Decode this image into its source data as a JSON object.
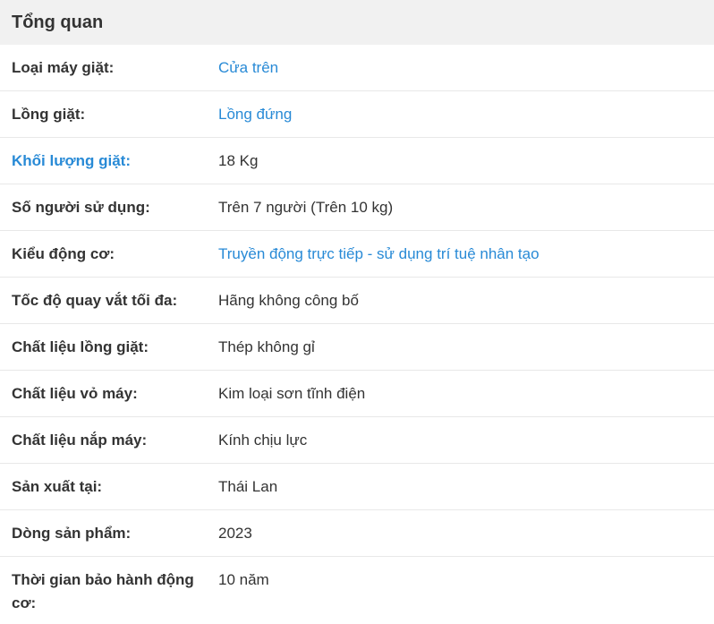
{
  "section": {
    "title": "Tổng quan"
  },
  "rows": [
    {
      "label": "Loại máy giặt:",
      "value": "Cửa trên"
    },
    {
      "label": "Lồng giặt:",
      "value": "Lồng đứng"
    },
    {
      "label": "Khối lượng giặt:",
      "value": "18 Kg"
    },
    {
      "label": "Số người sử dụng:",
      "value": "Trên 7 người (Trên 10 kg)"
    },
    {
      "label": "Kiểu động cơ:",
      "value": "Truyền động trực tiếp - sử dụng trí tuệ nhân tạo"
    },
    {
      "label": "Tốc độ quay vắt tối đa:",
      "value": "Hãng không công bố"
    },
    {
      "label": "Chất liệu lồng giặt:",
      "value": "Thép không gỉ"
    },
    {
      "label": "Chất liệu vỏ máy:",
      "value": "Kim loại sơn tĩnh điện"
    },
    {
      "label": "Chất liệu nắp máy:",
      "value": "Kính chịu lực"
    },
    {
      "label": "Sản xuất tại:",
      "value": "Thái Lan"
    },
    {
      "label": "Dòng sản phẩm:",
      "value": "2023"
    },
    {
      "label": "Thời gian bảo hành động cơ:",
      "value": "10 năm"
    }
  ],
  "colors": {
    "link": "#288ad6",
    "text": "#333333",
    "header_bg": "#f1f1f1",
    "divider": "#e8e8e8"
  }
}
